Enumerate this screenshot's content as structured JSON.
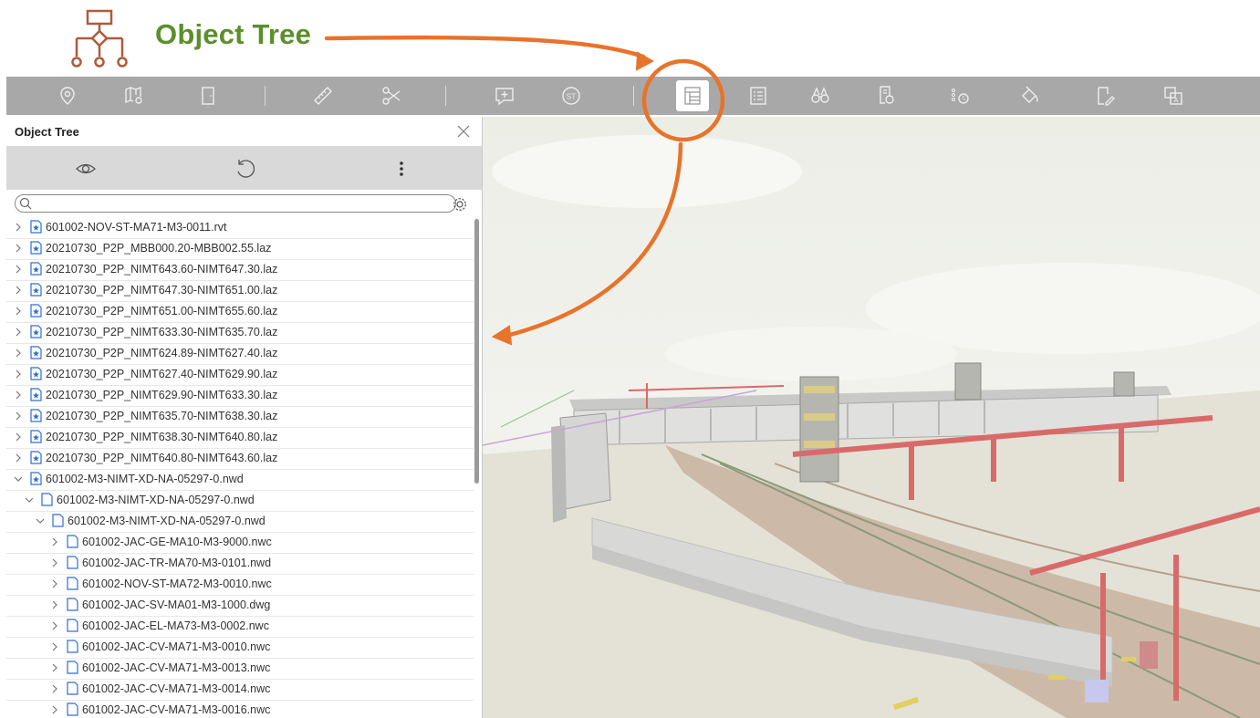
{
  "annotation": {
    "title": "Object Tree",
    "icon": "object-tree-hierarchy-icon"
  },
  "toolbar": {
    "buttons": [
      {
        "name": "location-pin-icon"
      },
      {
        "name": "map-pin-icon"
      },
      {
        "name": "door-icon"
      },
      {
        "name": "ruler-icon"
      },
      {
        "name": "scissors-icon"
      },
      {
        "name": "add-comment-icon"
      },
      {
        "name": "st-icon",
        "label": "ST"
      },
      {
        "name": "object-tree-icon",
        "active": true
      },
      {
        "name": "properties-list-icon"
      },
      {
        "name": "binoculars-icon"
      },
      {
        "name": "search-document-icon"
      },
      {
        "name": "settings-list-icon"
      },
      {
        "name": "paint-bucket-icon"
      },
      {
        "name": "edit-document-icon"
      },
      {
        "name": "layers-a-icon"
      }
    ]
  },
  "panel": {
    "title": "Object Tree",
    "search_placeholder": "",
    "tree": [
      {
        "label": "601002-NOV-ST-MA71-M3-0011.rvt",
        "level": 0,
        "expanded": false,
        "type": "model"
      },
      {
        "label": "20210730_P2P_MBB000.20-MBB002.55.laz",
        "level": 0,
        "expanded": false,
        "type": "model"
      },
      {
        "label": "20210730_P2P_NIMT643.60-NIMT647.30.laz",
        "level": 0,
        "expanded": false,
        "type": "model"
      },
      {
        "label": "20210730_P2P_NIMT647.30-NIMT651.00.laz",
        "level": 0,
        "expanded": false,
        "type": "model"
      },
      {
        "label": "20210730_P2P_NIMT651.00-NIMT655.60.laz",
        "level": 0,
        "expanded": false,
        "type": "model"
      },
      {
        "label": "20210730_P2P_NIMT633.30-NIMT635.70.laz",
        "level": 0,
        "expanded": false,
        "type": "model"
      },
      {
        "label": "20210730_P2P_NIMT624.89-NIMT627.40.laz",
        "level": 0,
        "expanded": false,
        "type": "model"
      },
      {
        "label": "20210730_P2P_NIMT627.40-NIMT629.90.laz",
        "level": 0,
        "expanded": false,
        "type": "model"
      },
      {
        "label": "20210730_P2P_NIMT629.90-NIMT633.30.laz",
        "level": 0,
        "expanded": false,
        "type": "model"
      },
      {
        "label": "20210730_P2P_NIMT635.70-NIMT638.30.laz",
        "level": 0,
        "expanded": false,
        "type": "model"
      },
      {
        "label": "20210730_P2P_NIMT638.30-NIMT640.80.laz",
        "level": 0,
        "expanded": false,
        "type": "model"
      },
      {
        "label": "20210730_P2P_NIMT640.80-NIMT643.60.laz",
        "level": 0,
        "expanded": false,
        "type": "model"
      },
      {
        "label": "601002-M3-NIMT-XD-NA-05297-0.nwd",
        "level": 0,
        "expanded": true,
        "type": "model"
      },
      {
        "label": "601002-M3-NIMT-XD-NA-05297-0.nwd",
        "level": 1,
        "expanded": true,
        "type": "file"
      },
      {
        "label": "601002-M3-NIMT-XD-NA-05297-0.nwd",
        "level": 2,
        "expanded": true,
        "type": "file"
      },
      {
        "label": "601002-JAC-GE-MA10-M3-9000.nwc",
        "level": 3,
        "expanded": false,
        "type": "file"
      },
      {
        "label": "601002-JAC-TR-MA70-M3-0101.nwd",
        "level": 3,
        "expanded": false,
        "type": "file"
      },
      {
        "label": "601002-NOV-ST-MA72-M3-0010.nwc",
        "level": 3,
        "expanded": false,
        "type": "file"
      },
      {
        "label": "601002-JAC-SV-MA01-M3-1000.dwg",
        "level": 3,
        "expanded": false,
        "type": "file"
      },
      {
        "label": "601002-JAC-EL-MA73-M3-0002.nwc",
        "level": 3,
        "expanded": false,
        "type": "file"
      },
      {
        "label": "601002-JAC-CV-MA71-M3-0010.nwc",
        "level": 3,
        "expanded": false,
        "type": "file"
      },
      {
        "label": "601002-JAC-CV-MA71-M3-0013.nwc",
        "level": 3,
        "expanded": false,
        "type": "file"
      },
      {
        "label": "601002-JAC-CV-MA71-M3-0014.nwc",
        "level": 3,
        "expanded": false,
        "type": "file"
      },
      {
        "label": "601002-JAC-CV-MA71-M3-0016.nwc",
        "level": 3,
        "expanded": false,
        "type": "file"
      }
    ]
  },
  "colors": {
    "annotation_orange": "#e8732a",
    "annotation_green": "#5b8f2b",
    "toolbar_gray": "#a8a8a8",
    "model_icon_blue": "#2f6fd0"
  }
}
